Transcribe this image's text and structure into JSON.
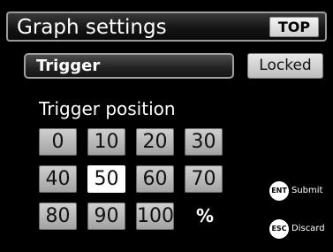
{
  "header": {
    "title": "Graph settings",
    "top_label": "TOP"
  },
  "trigger": {
    "selected_label": "Trigger",
    "locked_label": "Locked"
  },
  "trigger_position": {
    "title": "Trigger position",
    "options": [
      "0",
      "10",
      "20",
      "30",
      "40",
      "50",
      "60",
      "70",
      "80",
      "90",
      "100"
    ],
    "selected": "50",
    "unit": "%"
  },
  "hints": {
    "submit": {
      "key": "ENT",
      "label": "Submit"
    },
    "discard": {
      "key": "ESC",
      "label": "Discard"
    }
  }
}
